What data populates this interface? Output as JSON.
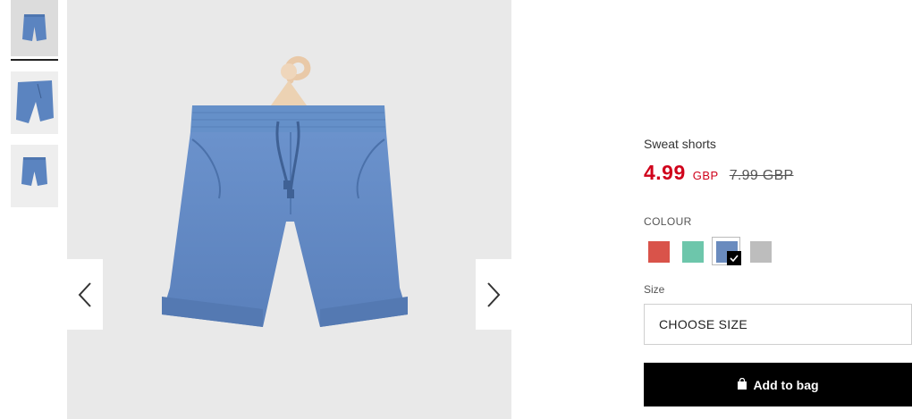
{
  "product": {
    "title": "Sweat shorts",
    "price": "4.99",
    "currency": "GBP",
    "old_price": "7.99 GBP",
    "colour_label": "COLOUR",
    "colours": [
      {
        "name": "red",
        "hex": "#d9534a"
      },
      {
        "name": "mint",
        "hex": "#6dc6ab"
      },
      {
        "name": "blue",
        "hex": "#6a8bbe",
        "selected": true
      },
      {
        "name": "grey",
        "hex": "#bdbdbd"
      }
    ],
    "size_label": "Size",
    "size_select": "CHOOSE SIZE",
    "add_button": "Add to bag"
  },
  "gallery": {
    "thumbnails": 3,
    "active_thumbnail": 1,
    "prev_icon": "chevron-left-icon",
    "next_icon": "chevron-right-icon"
  },
  "colors": {
    "accent_price": "#d0021b",
    "button_bg": "#000000",
    "denim": "#5b84c0"
  }
}
